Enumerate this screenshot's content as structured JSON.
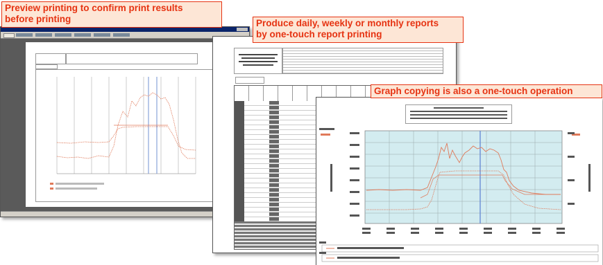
{
  "callouts": {
    "preview": "Preview printing to confirm print results\nbefore printing",
    "reports": "Produce daily, weekly or monthly reports\nby one-touch report printing",
    "graph": "Graph copying is also a one-touch operation"
  },
  "colors": {
    "callout_text": "#e63312",
    "callout_bg": "#fde6d6",
    "titlebar": "#0a246a",
    "plot_bg": "#d3ecf0",
    "series": "#e07a5a",
    "grid": "#9a9a9a"
  }
}
